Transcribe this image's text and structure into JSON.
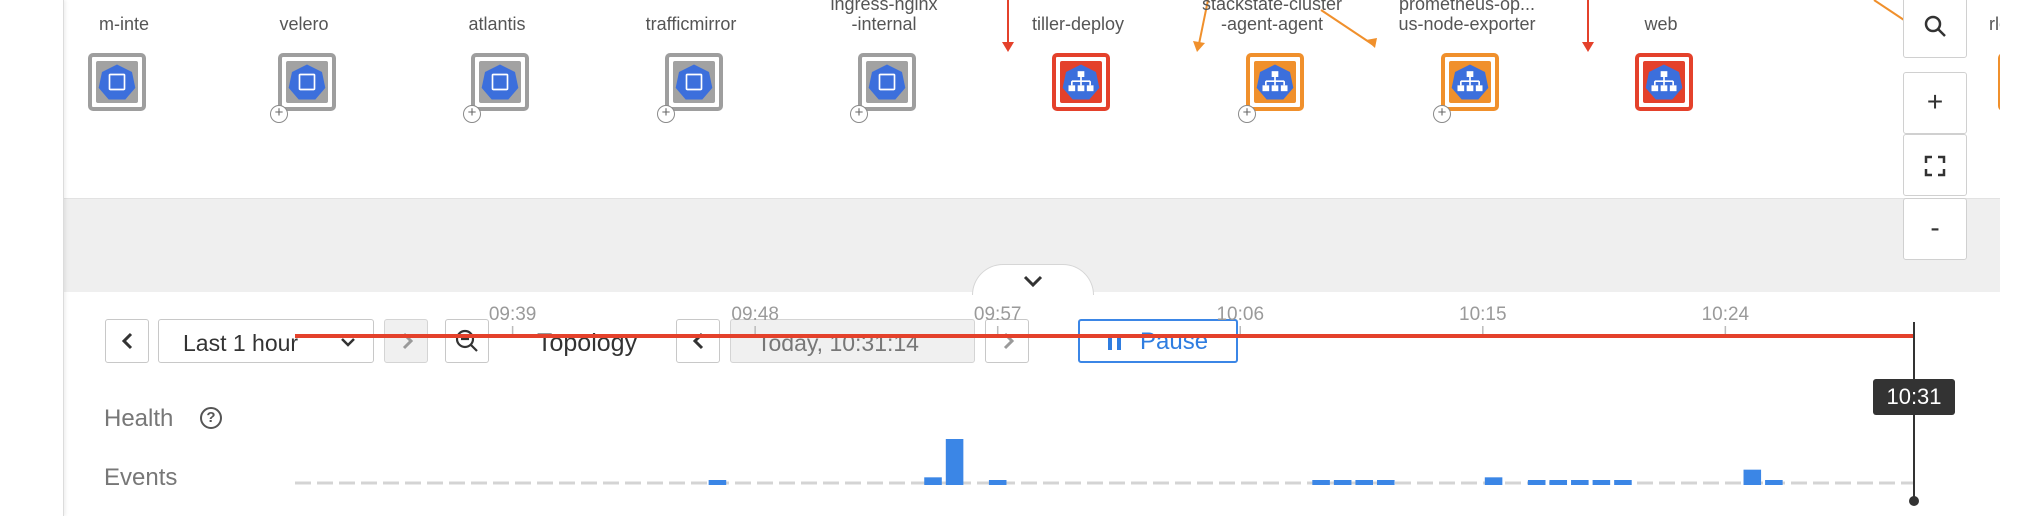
{
  "nodes": [
    {
      "label": "m-inte",
      "lines": 1,
      "state": "gray",
      "icon": "namespace-icon",
      "has_plus": false
    },
    {
      "label": "velero",
      "lines": 1,
      "state": "gray",
      "icon": "namespace-icon",
      "has_plus": true
    },
    {
      "label": "atlantis",
      "lines": 1,
      "state": "gray",
      "icon": "namespace-icon",
      "has_plus": true
    },
    {
      "label": "trafficmirror",
      "lines": 1,
      "state": "gray",
      "icon": "namespace-icon",
      "has_plus": true
    },
    {
      "label": "ingress-nginx\n-internal",
      "lines": 2,
      "state": "gray",
      "icon": "namespace-icon",
      "has_plus": true
    },
    {
      "label": "tiller-deploy",
      "lines": 1,
      "state": "red",
      "icon": "deployment-icon",
      "has_plus": false
    },
    {
      "label": "stackstate-cluster\n-agent-agent",
      "lines": 2,
      "state": "orange",
      "icon": "deployment-icon",
      "has_plus": true
    },
    {
      "label": "prometheus-op...\nus-node-exporter",
      "lines": 2,
      "state": "orange",
      "icon": "deployment-icon",
      "has_plus": true
    },
    {
      "label": "web",
      "lines": 1,
      "state": "red",
      "icon": "deployment-icon",
      "has_plus": false
    },
    {
      "label": "rlog",
      "lines": 1,
      "state": "orange",
      "icon": "storage-icon",
      "has_plus": false
    }
  ],
  "zoom_controls": {
    "search": "search-icon",
    "zoom_in": "+",
    "fit": "fit-screen-icon",
    "zoom_out": "-"
  },
  "timeline": {
    "range_label": "Last 1 hour",
    "topology_label": "Topology",
    "timestamp": "Today, 10:31:14",
    "pause_label": "Pause",
    "health_label": "Health",
    "events_label": "Events",
    "help_symbol": "?",
    "now_label": "10:31"
  },
  "chart_data": {
    "type": "bar",
    "title": "",
    "x_ticks": [
      "09:39",
      "09:48",
      "09:57",
      "10:06",
      "10:15",
      "10:24"
    ],
    "x_range": [
      "09:31",
      "10:31"
    ],
    "health": {
      "state": "critical",
      "color": "#e4412b"
    },
    "events": {
      "bin_minutes": 1,
      "values": [
        0,
        0,
        0,
        0,
        0,
        0,
        0,
        0,
        0,
        0,
        0,
        0,
        0,
        0,
        0,
        0,
        0,
        0,
        0,
        1,
        0,
        0,
        0,
        0,
        0,
        0,
        0,
        0,
        0,
        2,
        12,
        0,
        1,
        0,
        0,
        0,
        0,
        0,
        0,
        0,
        0,
        0,
        0,
        0,
        0,
        0,
        0,
        1,
        1,
        1,
        1,
        0,
        0,
        0,
        0,
        2,
        0,
        1,
        1,
        1,
        1,
        1,
        0,
        0,
        0,
        0,
        0,
        4,
        1,
        0,
        0,
        0,
        0,
        0,
        0
      ],
      "color": "#3b86e6"
    }
  }
}
